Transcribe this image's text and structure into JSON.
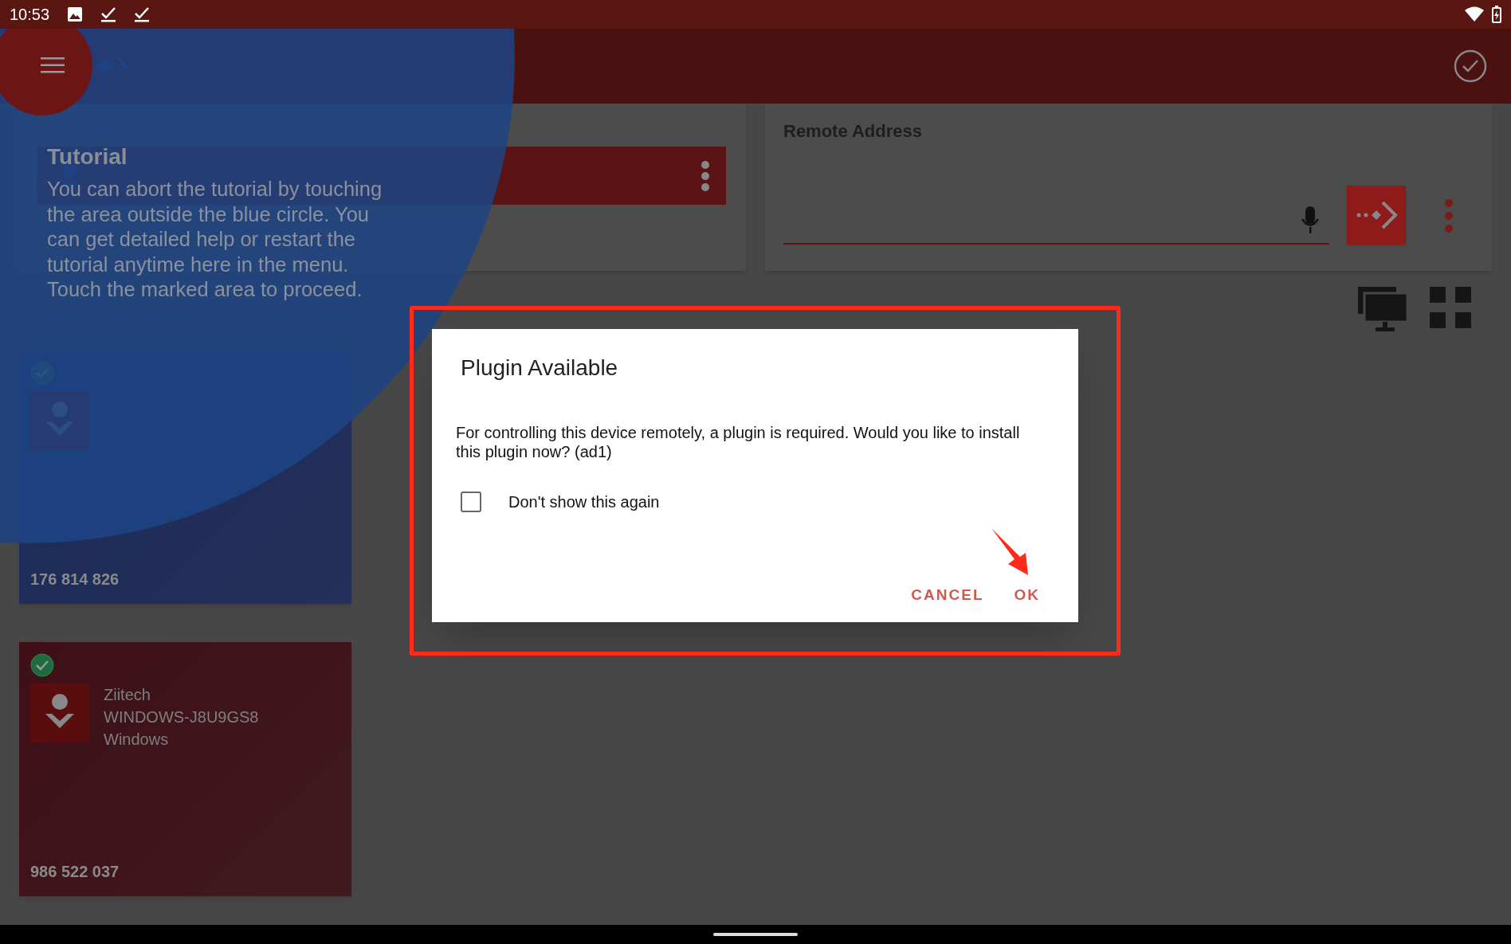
{
  "status_bar": {
    "time": "10:53"
  },
  "remote_address": {
    "label": "Remote Address"
  },
  "tutorial": {
    "title": "Tutorial",
    "text": "You can abort the tutorial by touching the area outside the blue circle. You can get detailed help or restart the tutorial anytime here in the menu. Touch the marked area to proceed."
  },
  "recent_sessions": [
    {
      "color": "#1b2a5c",
      "number": "176 814 826"
    },
    {
      "color": "#3e0f17",
      "name": "Ziitech",
      "host": "WINDOWS-J8U9GS8",
      "os": "Windows",
      "number": "986 522 037"
    }
  ],
  "dialog": {
    "title": "Plugin Available",
    "message": "For controlling this device remotely, a plugin is required. Would you like to install this plugin now? (ad1)",
    "checkbox": {
      "label": "Don't show this again",
      "checked": false
    },
    "buttons": [
      {
        "label": "CANCEL"
      },
      {
        "label": "OK"
      }
    ]
  }
}
